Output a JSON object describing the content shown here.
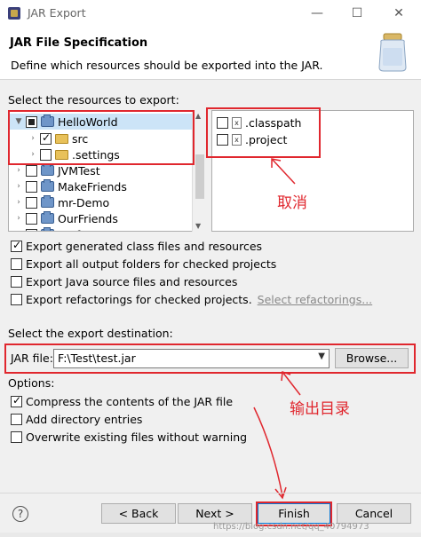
{
  "window": {
    "title": "JAR Export",
    "minimize": "—",
    "maximize": "☐",
    "close": "✕"
  },
  "header": {
    "title": "JAR File Specification",
    "description": "Define which resources should be exported into the JAR."
  },
  "resources": {
    "label": "Select the resources to export:",
    "tree": [
      {
        "label": "HelloWorld",
        "state": "partial",
        "expanded": true
      },
      {
        "label": "src",
        "state": "checked"
      },
      {
        "label": ".settings",
        "state": "unchecked"
      },
      {
        "label": "JVMTest",
        "state": "unchecked"
      },
      {
        "label": "MakeFriends",
        "state": "unchecked"
      },
      {
        "label": "mr-Demo",
        "state": "unchecked"
      },
      {
        "label": "OurFriends",
        "state": "unchecked"
      },
      {
        "label": "perfect",
        "state": "unchecked"
      }
    ],
    "files": [
      {
        "label": ".classpath",
        "state": "unchecked"
      },
      {
        "label": ".project",
        "state": "unchecked"
      }
    ]
  },
  "annotations": {
    "cancel": "取消",
    "output_dir": "输出目录"
  },
  "export_options": [
    {
      "label": "Export generated class files and resources",
      "checked": true
    },
    {
      "label": "Export all output folders for checked projects",
      "checked": false
    },
    {
      "label": "Export Java source files and resources",
      "checked": false
    },
    {
      "label": "Export refactorings for checked projects.",
      "checked": false
    }
  ],
  "select_refactorings": "Select refactorings...",
  "destination": {
    "label": "Select the export destination:",
    "jar_label": "JAR file:",
    "jar_value": "F:\\Test\\test.jar",
    "browse": "Browse..."
  },
  "options": {
    "label": "Options:",
    "items": [
      {
        "label": "Compress the contents of the JAR file",
        "checked": true
      },
      {
        "label": "Add directory entries",
        "checked": false
      },
      {
        "label": "Overwrite existing files without warning",
        "checked": false
      }
    ]
  },
  "buttons": {
    "help": "?",
    "back": "< Back",
    "next": "Next >",
    "finish": "Finish",
    "cancel": "Cancel"
  },
  "watermark": "https://blog.csdn.net/qq_40794973"
}
